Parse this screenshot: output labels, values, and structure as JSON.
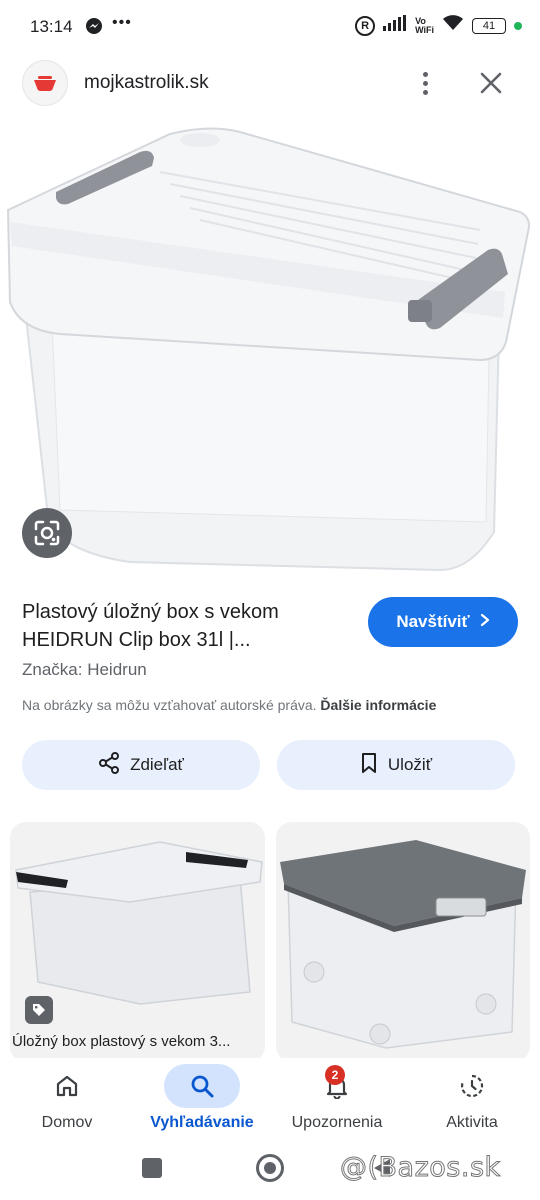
{
  "status_bar": {
    "time": "13:14",
    "registered_mark": "R",
    "network_label_top": "Vo",
    "network_label_bottom": "WiFi",
    "battery": "41",
    "icons": [
      "messenger-icon",
      "signal-icon",
      "wifi-icon",
      "battery-icon"
    ]
  },
  "header": {
    "site": "mojkastrolik.sk",
    "more_icon": "more-vert-icon",
    "close_icon": "close-icon"
  },
  "product": {
    "title": "Plastový úložný box s vekom HEIDRUN Clip box 31l |...",
    "visit_label": "Navštíviť",
    "brand": "Značka: Heidrun",
    "copyright_text": "Na obrázky sa môžu vzťahovať autorské práva.",
    "more_info": "Ďalšie informácie",
    "share_label": "Zdieľať",
    "save_label": "Uložiť"
  },
  "results": [
    {
      "title": "Úložný box plastový s vekom 3...",
      "badge_icon": "tag-icon"
    },
    {
      "title": ""
    }
  ],
  "bottom_nav": {
    "items": [
      {
        "label": "Domov",
        "icon": "home-icon"
      },
      {
        "label": "Vyhľadávanie",
        "icon": "search-icon",
        "active": true
      },
      {
        "label": "Upozornenia",
        "icon": "bell-icon",
        "badge": "2"
      },
      {
        "label": "Aktivita",
        "icon": "history-icon"
      }
    ]
  },
  "watermark": "@(Bazos.sk",
  "colors": {
    "accent": "#1a73e8",
    "pill_bg": "#e8f0fe",
    "active_nav_bg": "#d3e3fd",
    "badge_red": "#d93025"
  }
}
